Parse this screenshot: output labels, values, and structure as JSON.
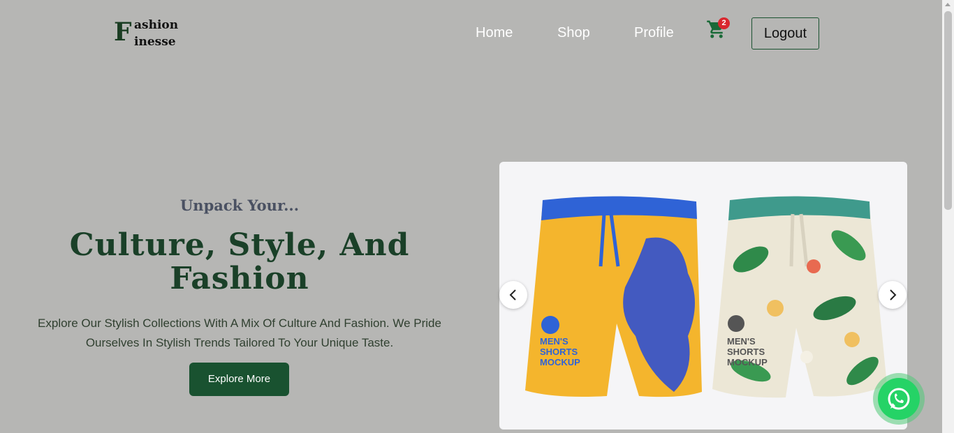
{
  "brand": {
    "initial": "F",
    "line1": "ashion",
    "line2": "inesse"
  },
  "nav": {
    "home": "Home",
    "shop": "Shop",
    "profile": "Profile"
  },
  "cart": {
    "count": "2",
    "icon": "cart-icon"
  },
  "auth": {
    "logout_label": "Logout"
  },
  "hero": {
    "kicker": "Unpack Your...",
    "headline": "Culture, Style, And Fashion",
    "description": "Explore Our Stylish Collections With A Mix Of Culture And Fashion. We Pride Ourselves In Stylish Trends Tailored To Your Unique Taste.",
    "cta_label": "Explore More"
  },
  "carousel": {
    "prev_icon": "chevron-left-icon",
    "next_icon": "chevron-right-icon",
    "slide": {
      "left_label": "MEN'S SHORTS MOCKUP",
      "right_label": "MEN'S SHORTS MOCKUP"
    }
  },
  "whatsapp": {
    "icon": "whatsapp-icon"
  },
  "colors": {
    "background": "#b6b6b4",
    "brand_green": "#195230",
    "badge_red": "#d9272e",
    "whatsapp": "#25d366"
  }
}
